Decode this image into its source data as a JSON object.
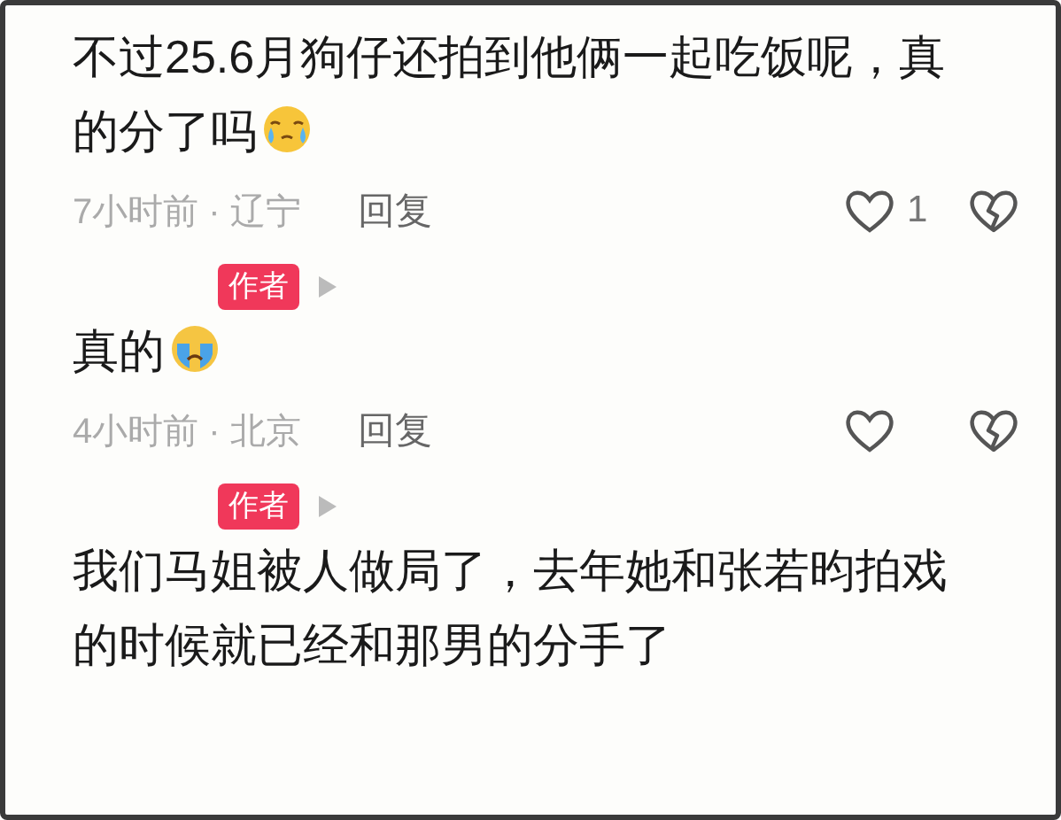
{
  "comments": [
    {
      "text": "不过25.6月狗仔还拍到他俩一起吃饭呢，真的分了吗",
      "emoji": {
        "kind": "crying"
      },
      "meta": "7小时前 · 辽宁",
      "reply": "回复",
      "likes": "1"
    },
    {
      "author_tag": "作者",
      "text": "真的",
      "emoji": {
        "kind": "sobbing"
      },
      "meta": "4小时前 · 北京",
      "reply": "回复"
    },
    {
      "author_tag": "作者",
      "text": "我们马姐被人做局了，去年她和张若昀拍戏的时候就已经和那男的分手了"
    }
  ]
}
